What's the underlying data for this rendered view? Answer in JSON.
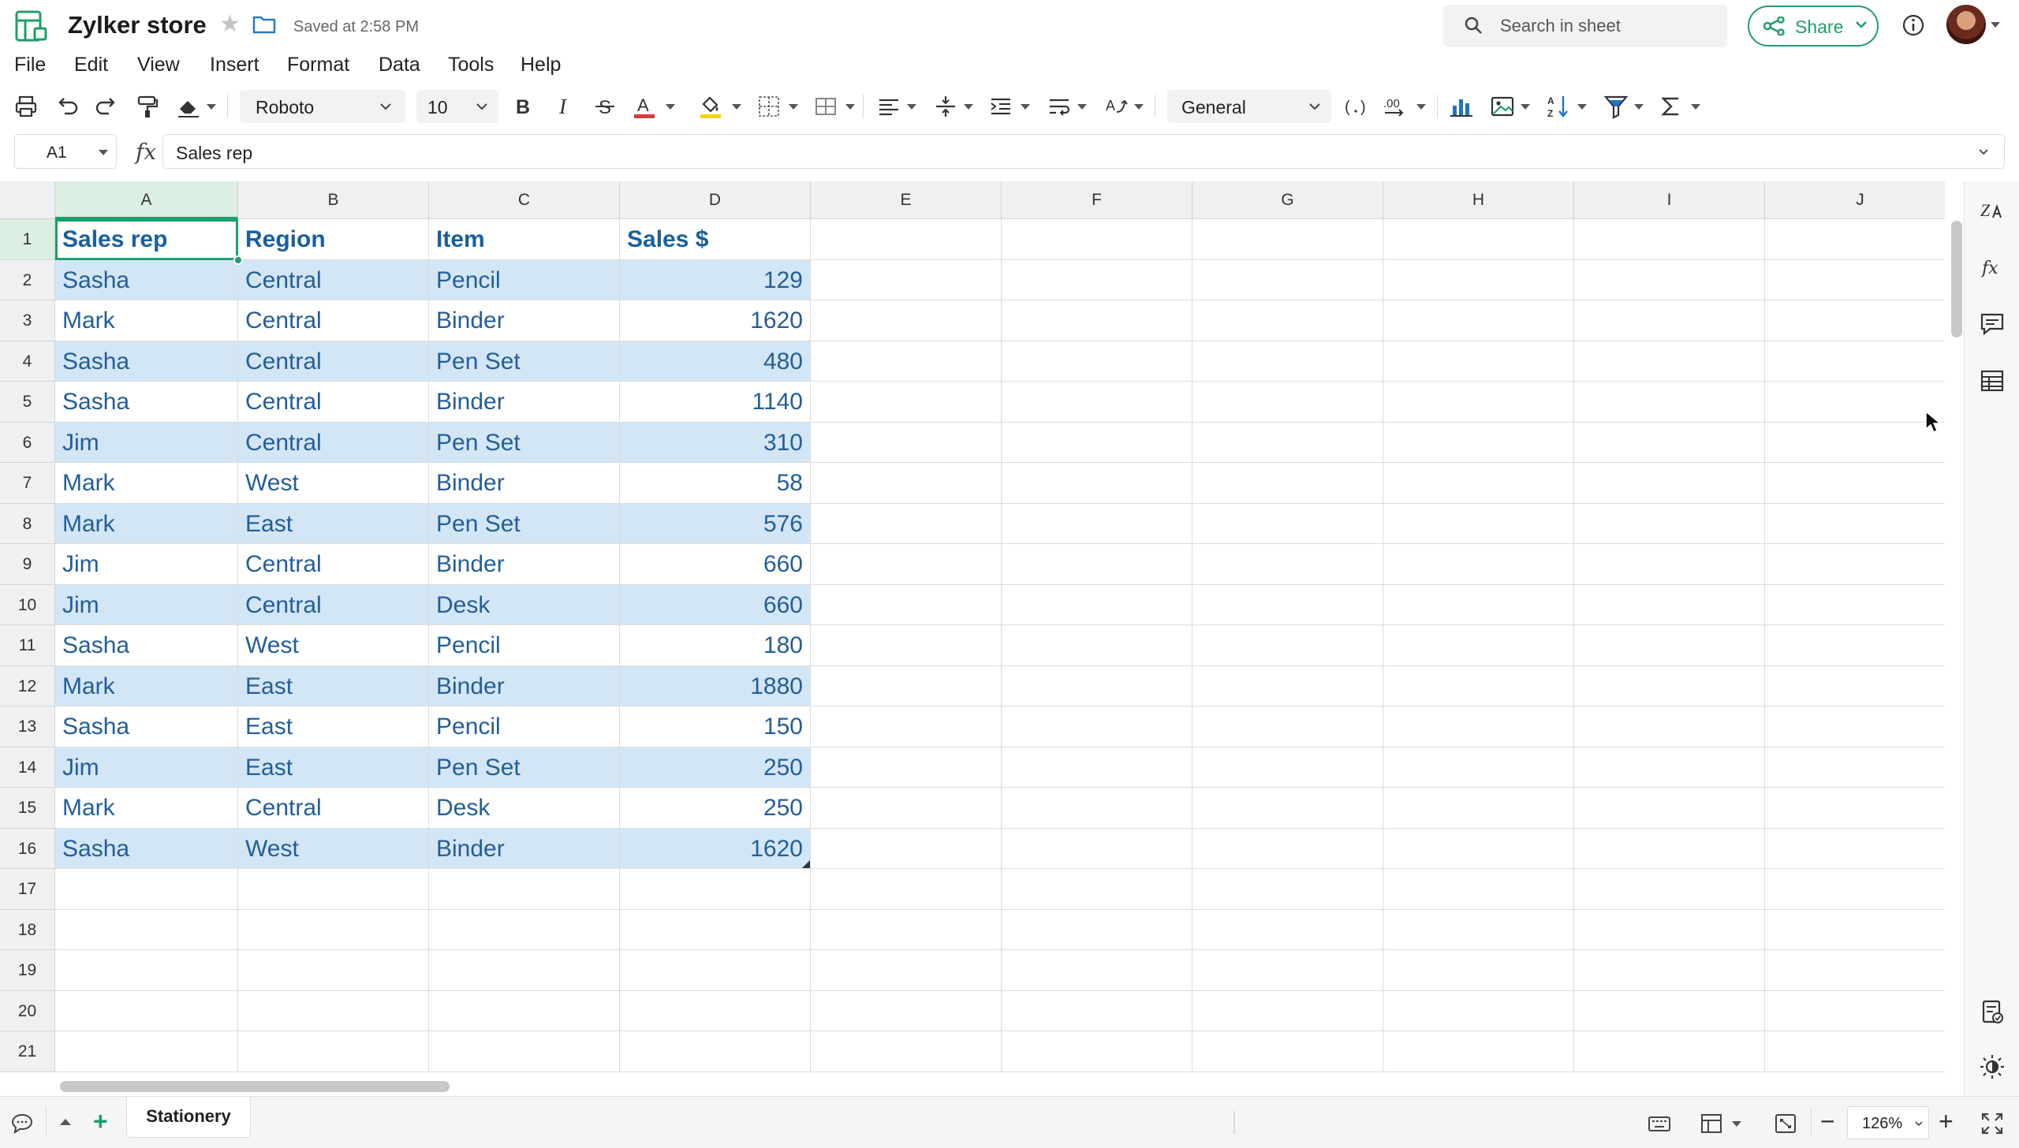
{
  "app": {
    "title": "Zylker store",
    "saved_status": "Saved at 2:58 PM",
    "search_placeholder": "Search in sheet",
    "share_label": "Share",
    "brand_color": "#1f9e6a",
    "icons": {
      "logo": "spreadsheet-logo-icon",
      "star": "star-icon",
      "folder": "folder-icon",
      "search": "search-icon",
      "share": "share-icon",
      "info": "info-icon"
    }
  },
  "menu": [
    "File",
    "Edit",
    "View",
    "Insert",
    "Format",
    "Data",
    "Tools",
    "Help"
  ],
  "toolbar": {
    "font": "Roboto",
    "font_size": "10",
    "number_format": "General",
    "decimal_label": ".00"
  },
  "formula_bar": {
    "cell_ref": "A1",
    "fx": "fx",
    "content": "Sales rep"
  },
  "grid": {
    "columns": [
      "A",
      "B",
      "C",
      "D",
      "E",
      "F",
      "G",
      "H",
      "I",
      "J"
    ],
    "visible_rows": 21,
    "selected_cell": "A1",
    "header_row": [
      "Sales rep",
      "Region",
      "Item",
      "Sales $"
    ],
    "rows": [
      [
        "Sasha",
        "Central",
        "Pencil",
        "129"
      ],
      [
        "Mark",
        "Central",
        "Binder",
        "1620"
      ],
      [
        "Sasha",
        "Central",
        "Pen Set",
        "480"
      ],
      [
        "Sasha",
        "Central",
        "Binder",
        "1140"
      ],
      [
        "Jim",
        "Central",
        "Pen Set",
        "310"
      ],
      [
        "Mark",
        "West",
        "Binder",
        "58"
      ],
      [
        "Mark",
        "East",
        "Pen Set",
        "576"
      ],
      [
        "Jim",
        "Central",
        "Binder",
        "660"
      ],
      [
        "Jim",
        "Central",
        "Desk",
        "660"
      ],
      [
        "Sasha",
        "West",
        "Pencil",
        "180"
      ],
      [
        "Mark",
        "East",
        "Binder",
        "1880"
      ],
      [
        "Sasha",
        "East",
        "Pencil",
        "150"
      ],
      [
        "Jim",
        "East",
        "Pen Set",
        "250"
      ],
      [
        "Mark",
        "Central",
        "Desk",
        "250"
      ],
      [
        "Sasha",
        "West",
        "Binder",
        "1620"
      ]
    ],
    "band_color": "#d3e6f5",
    "text_color": "#235e98"
  },
  "bottom": {
    "sheet_tab": "Stationery",
    "zoom": "126%",
    "zoom_out": "−",
    "zoom_in": "+",
    "add_sheet": "+"
  }
}
